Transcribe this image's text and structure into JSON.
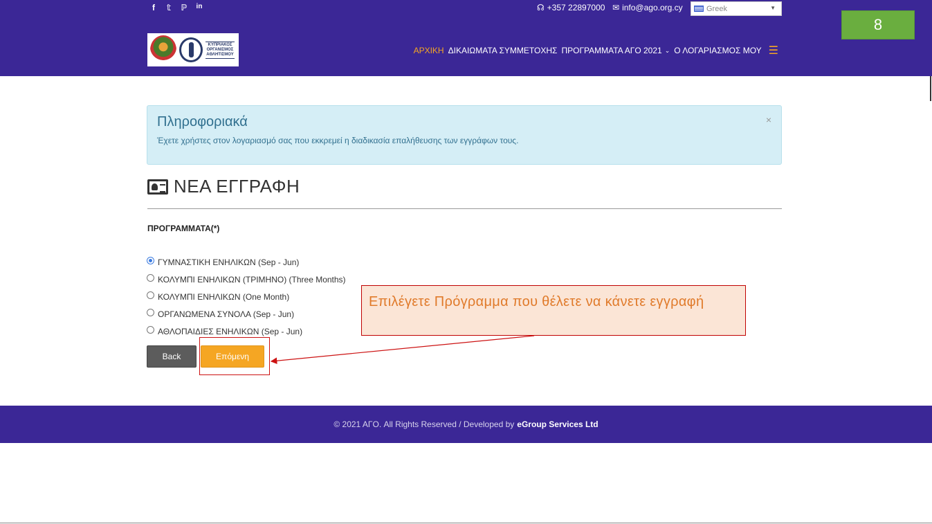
{
  "header": {
    "social": [
      "f",
      "𝕥",
      "ℙ",
      "in"
    ],
    "phone": "+357 22897000",
    "email": "info@ago.org.cy",
    "language": "Greek",
    "logo_text": "ΚΥΠΡΙΑΚΟΣ ΟΡΓΑΝΙΣΜΟΣ ΑΘΛΗΤΙΣΜΟΥ",
    "nav": {
      "home": "ΑΡΧΙΚΗ",
      "fees": "ΔΙΚΑΙΩΜΑΤΑ ΣΥΜΜΕΤΟΧΗΣ",
      "programs": "ΠΡΟΓΡΑΜΜΑΤΑ ΑΓΟ 2021",
      "account": "Ο ΛΟΓΑΡΙΑΣΜΟΣ ΜΟΥ"
    },
    "colors": {
      "bar": "#3b2796",
      "accent": "#f5a623"
    }
  },
  "step_badge": "8",
  "alert": {
    "title": "Πληροφοριακά",
    "message": "Έχετε χρήστες στον λογαριασμό σας που εκκρεμεί η διαδικασία επαλήθευσης των εγγράφων τους.",
    "close": "×"
  },
  "page": {
    "heading": "ΝΕΑ ΕΓΓΡΑΦΗ",
    "programs_label": "ΠΡΟΓΡΑΜΜΑΤΑ(*)",
    "options": [
      {
        "label": "ΓΥΜΝΑΣΤΙΚΗ ΕΝΗΛΙΚΩΝ (Sep - Jun)",
        "checked": true
      },
      {
        "label": "ΚΟΛΥΜΠΙ ΕΝΗΛΙΚΩΝ (ΤΡΙΜΗΝΟ) (Three Months)",
        "checked": false
      },
      {
        "label": "ΚΟΛΥΜΠΙ ΕΝΗΛΙΚΩΝ (One Month)",
        "checked": false
      },
      {
        "label": "ΟΡΓΑΝΩΜΕΝΑ ΣΥΝΟΛΑ (Sep - Jun)",
        "checked": false
      },
      {
        "label": "ΑΘΛΟΠΑΙΔΙΕΣ ΕΝΗΛΙΚΩΝ (Sep - Jun)",
        "checked": false
      }
    ],
    "back_label": "Back",
    "next_label": "Επόμενη"
  },
  "callout": {
    "text": "Επιλέγετε Πρόγραμμα που θέλετε να κάνετε εγγραφή"
  },
  "footer": {
    "text": "© 2021 ΑΓΟ. All Rights Reserved / Developed by",
    "developer": "eGroup Services Ltd"
  }
}
